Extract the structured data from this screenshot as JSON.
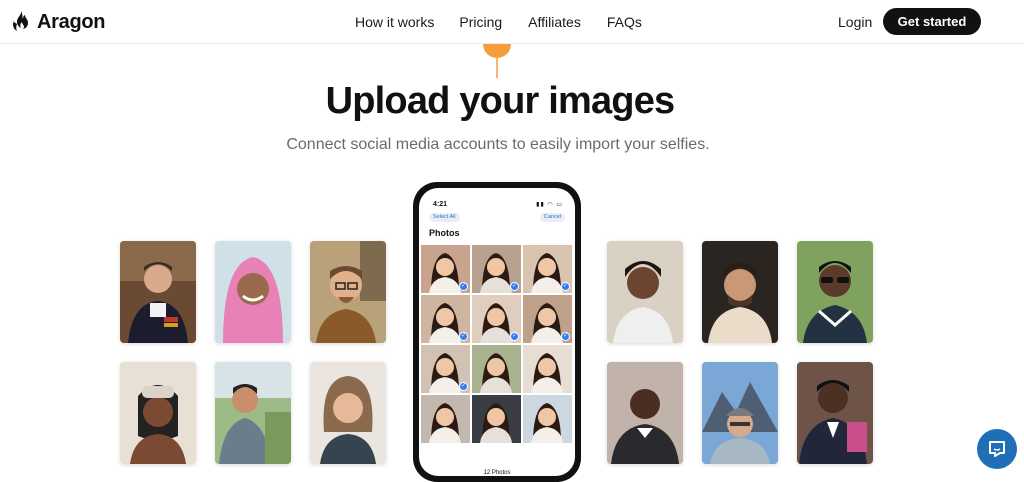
{
  "brand": {
    "name": "Aragon",
    "logo_icon": "flame-icon"
  },
  "nav": {
    "links": [
      "How it works",
      "Pricing",
      "Affiliates",
      "FAQs"
    ],
    "login_label": "Login",
    "cta_label": "Get started"
  },
  "hero": {
    "title": "Upload your images",
    "subtitle": "Connect social media accounts to easily import your selfies."
  },
  "phone": {
    "time": "4:21",
    "status_icons": "signal wifi battery",
    "select_all": "Select All",
    "cancel": "Cancel",
    "heading": "Photos",
    "photo_count": "12 Photos",
    "selected_cells": [
      0,
      1,
      2,
      3,
      4,
      5,
      6
    ]
  },
  "colors": {
    "accent": "#f59d3a",
    "cta_bg": "#111111",
    "check": "#2f7cf6",
    "chat": "#1f6fb7"
  },
  "chat_icon": "chat-bubble-icon"
}
